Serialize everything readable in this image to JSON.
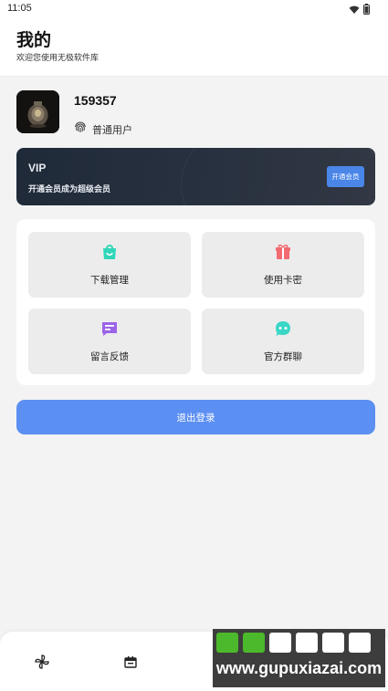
{
  "status_bar": {
    "time": "11:05"
  },
  "header": {
    "title": "我的",
    "subtitle": "欢迎您使用无极软件库"
  },
  "profile": {
    "username": "159357",
    "level": "普通用户"
  },
  "vip": {
    "title": "VIP",
    "description": "开通会员成为超级会员",
    "button_label": "开通会员"
  },
  "menu": [
    {
      "label": "下载管理",
      "icon": "shopping-bag-icon",
      "color": "#2fd7b8"
    },
    {
      "label": "使用卡密",
      "icon": "gift-icon",
      "color": "#f26b72"
    },
    {
      "label": "留言反馈",
      "icon": "message-icon",
      "color": "#9b63e8"
    },
    {
      "label": "官方群聊",
      "icon": "chat-bubble-icon",
      "color": "#3ad6c6"
    }
  ],
  "logout_label": "退出登录",
  "bottom_nav": [
    {
      "icon": "pinwheel-icon"
    },
    {
      "icon": "calendar-icon"
    }
  ],
  "watermark": {
    "text": "www.gupuxiazai.com"
  }
}
